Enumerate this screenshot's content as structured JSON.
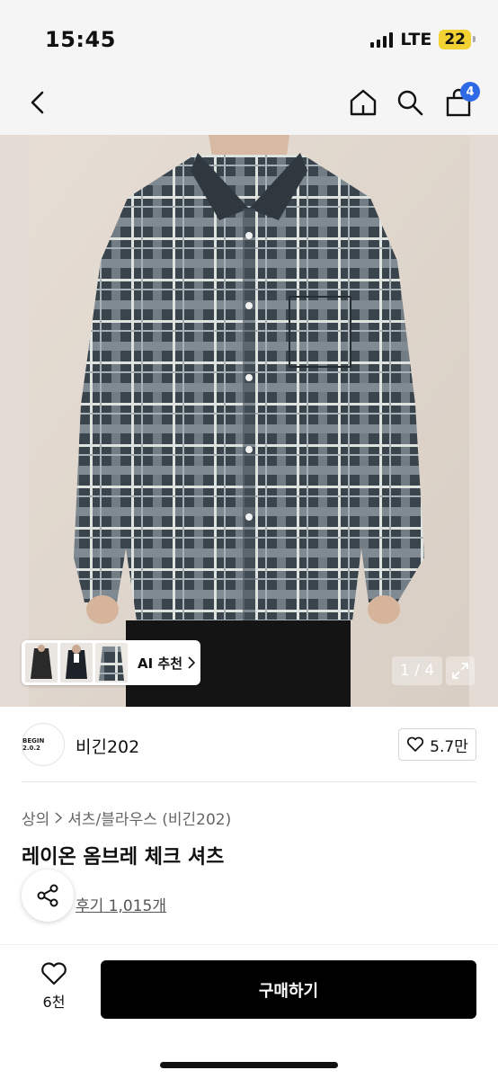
{
  "status_bar": {
    "time": "15:45",
    "network": "LTE",
    "battery": "22"
  },
  "nav": {
    "cart_count": "4",
    "icons": [
      "back-icon",
      "home-icon",
      "search-icon",
      "shopping-bag-icon"
    ]
  },
  "gallery": {
    "ai_label": "AI 추천",
    "counter": "1 / 4",
    "colors": {
      "background": "#e4dcd4",
      "shirt": "#3c4650",
      "check": "#d8dcd8"
    }
  },
  "brand": {
    "logo_text": "BEGIN 2.0.2",
    "name": "비긴202",
    "likes": "5.7만"
  },
  "product": {
    "breadcrumb_category": "상의",
    "breadcrumb_sub": "셔츠/블라우스 (비긴202)",
    "title": "레이온 옴브레 체크 셔츠",
    "reviews": "후기 1,015개"
  },
  "bottom_bar": {
    "wish_count": "6천",
    "buy_label": "구매하기",
    "accent": "#000000"
  }
}
